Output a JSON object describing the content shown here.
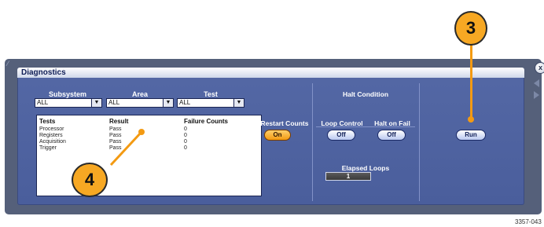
{
  "window": {
    "title": "Diagnostics",
    "close_glyph": "x",
    "corner_glyph": "⁄"
  },
  "filters": {
    "subsystem": {
      "label": "Subsystem",
      "value": "ALL"
    },
    "area": {
      "label": "Area",
      "value": "ALL"
    },
    "test": {
      "label": "Test",
      "value": "ALL"
    },
    "arrow_glyph": "▼"
  },
  "results": {
    "columns": [
      "Tests",
      "Result",
      "Failure Counts"
    ],
    "rows": [
      {
        "test": "Processor",
        "result": "Pass",
        "failures": "0"
      },
      {
        "test": "Registers",
        "result": "Pass",
        "failures": "0"
      },
      {
        "test": "Acquisition",
        "result": "Pass",
        "failures": "0"
      },
      {
        "test": "Trigger",
        "result": "Pass",
        "failures": "0"
      }
    ]
  },
  "restart_counts": {
    "label": "Restart Counts",
    "button": "On"
  },
  "halt_condition": {
    "title": "Halt Condition",
    "loop_control": {
      "label": "Loop Control",
      "button": "Off"
    },
    "halt_on_fail": {
      "label": "Halt on Fail",
      "button": "Off"
    }
  },
  "elapsed_loops": {
    "label": "Elapsed Loops",
    "value": "1"
  },
  "run_button": "Run",
  "callouts": {
    "run": "3",
    "results": "4"
  },
  "figure_id": "3357-043",
  "colors": {
    "dialog_blue": "#5468a5",
    "frame_grey": "#55607a",
    "accent_orange": "#f39a12",
    "title_navy": "#0e1d55"
  }
}
